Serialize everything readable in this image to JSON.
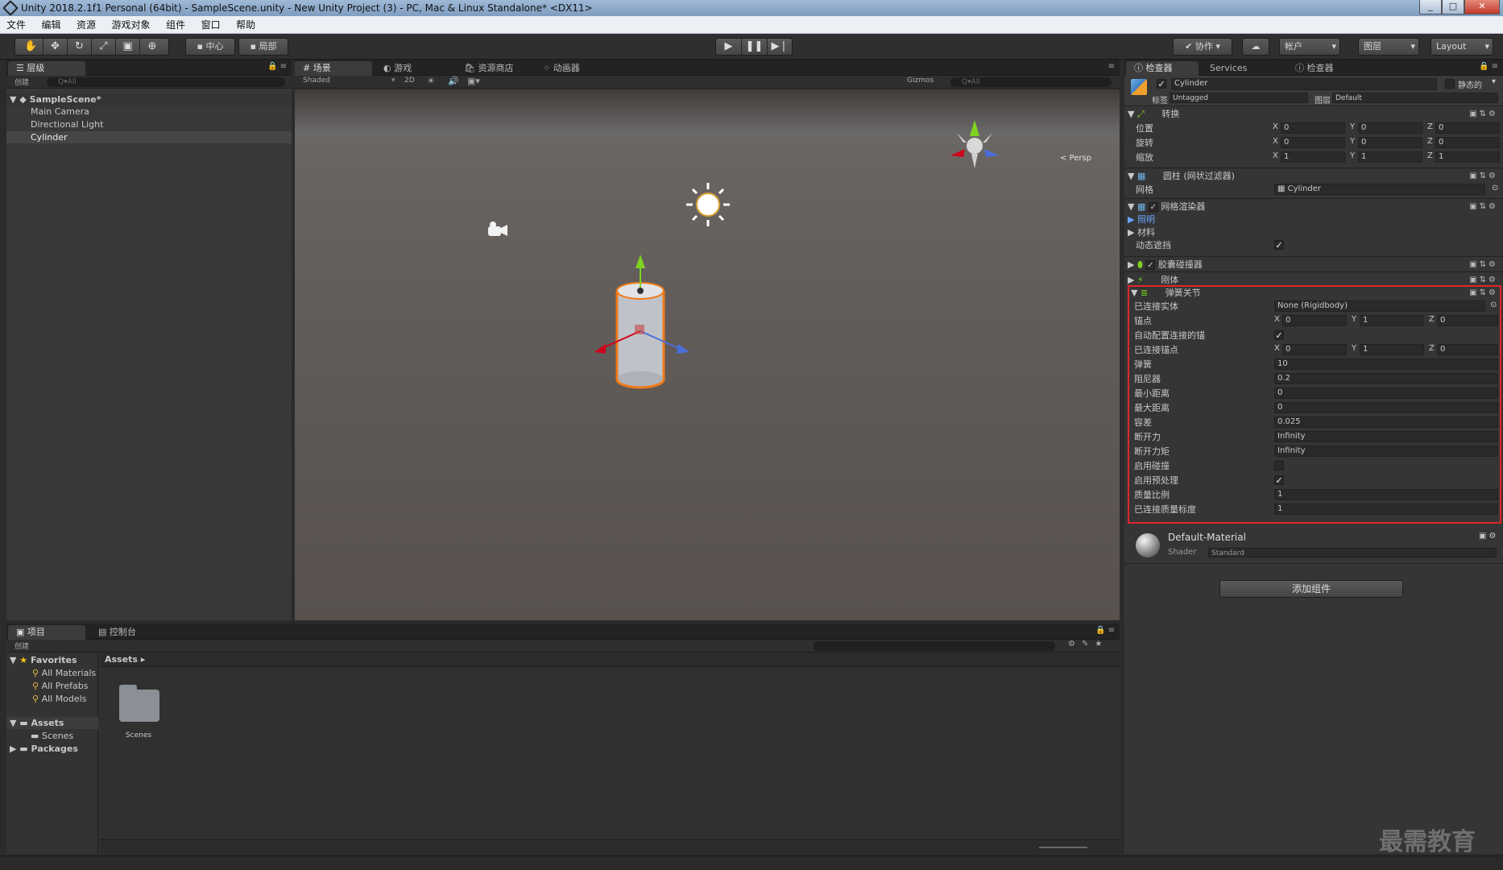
{
  "window": {
    "title": "Unity 2018.2.1f1 Personal (64bit) - SampleScene.unity - New Unity Project (3) - PC, Mac & Linux Standalone* <DX11>"
  },
  "menu": [
    "文件",
    "编辑",
    "资源",
    "游戏对象",
    "组件",
    "窗口",
    "帮助"
  ],
  "toolbar": {
    "pivot": "中心",
    "local": "局部",
    "collab": "协作",
    "account": "帐户",
    "layers": "图层",
    "layout": "Layout"
  },
  "hierarchy": {
    "tab": "层级",
    "create": "创建",
    "search": "Q▾All",
    "scene": "SampleScene*",
    "items": [
      "Main Camera",
      "Directional Light",
      "Cylinder"
    ]
  },
  "scene": {
    "tabs": [
      "场景",
      "游戏",
      "资源商店",
      "动画器"
    ],
    "shading": "Shaded",
    "mode2d": "2D",
    "gizmos": "Gizmos",
    "search": "Q▾All",
    "persp": "< Persp"
  },
  "project": {
    "tabs": [
      "项目",
      "控制台"
    ],
    "create": "创建",
    "favorites": "Favorites",
    "fav_items": [
      "All Materials",
      "All Prefabs",
      "All Models"
    ],
    "assets": "Assets",
    "asset_children": [
      "Scenes"
    ],
    "packages": "Packages",
    "breadcrumb": "Assets",
    "folder": "Scenes"
  },
  "inspector": {
    "tabs": [
      "检查器",
      "Services",
      "检查器"
    ],
    "object_name": "Cylinder",
    "static": "静态的",
    "tag_label": "标签",
    "tag": "Untagged",
    "layer_label": "图层",
    "layer": "Default",
    "transform": {
      "title": "转换",
      "rows": [
        {
          "label": "位置",
          "x": "0",
          "y": "0",
          "z": "0"
        },
        {
          "label": "旋转",
          "x": "0",
          "y": "0",
          "z": "0"
        },
        {
          "label": "缩放",
          "x": "1",
          "y": "1",
          "z": "1"
        }
      ]
    },
    "mesh_filter": {
      "title": "圆柱 (网状过滤器)",
      "mesh_label": "网格",
      "mesh": "Cylinder"
    },
    "mesh_renderer": {
      "title": "网格渲染器",
      "lighting": "照明",
      "materials": "材料",
      "dynamic": "动态遮挡"
    },
    "capsule": {
      "title": "胶囊碰撞器"
    },
    "rigidbody": {
      "title": "刚体"
    },
    "spring": {
      "title": "弹簧关节",
      "connected_body_label": "已连接实体",
      "connected_body": "None (Rigidbody)",
      "anchor_label": "锚点",
      "anchor": {
        "x": "0",
        "y": "1",
        "z": "0"
      },
      "auto_label": "自动配置连接的锚",
      "connected_anchor_label": "已连接锚点",
      "connected_anchor": {
        "x": "0",
        "y": "1",
        "z": "0"
      },
      "rows": [
        {
          "label": "弹簧",
          "value": "10"
        },
        {
          "label": "阻尼器",
          "value": "0.2"
        },
        {
          "label": "最小距离",
          "value": "0"
        },
        {
          "label": "最大距离",
          "value": "0"
        },
        {
          "label": "容差",
          "value": "0.025"
        },
        {
          "label": "断开力",
          "value": "Infinity"
        },
        {
          "label": "断开力矩",
          "value": "Infinity"
        }
      ],
      "collision_label": "启用碰撞",
      "preprocess_label": "启用预处理",
      "mass_label": "质量比例",
      "mass": "1",
      "connected_mass_label": "已连接质量标度",
      "connected_mass": "1"
    },
    "material": {
      "name": "Default-Material",
      "shader_label": "Shader",
      "shader": "Standard"
    },
    "add_component": "添加组件"
  },
  "watermark": "最需教育",
  "colors": {
    "highlight": "#e0262c",
    "selection": "#3e5f96",
    "accent_orange": "#f07a1a"
  }
}
